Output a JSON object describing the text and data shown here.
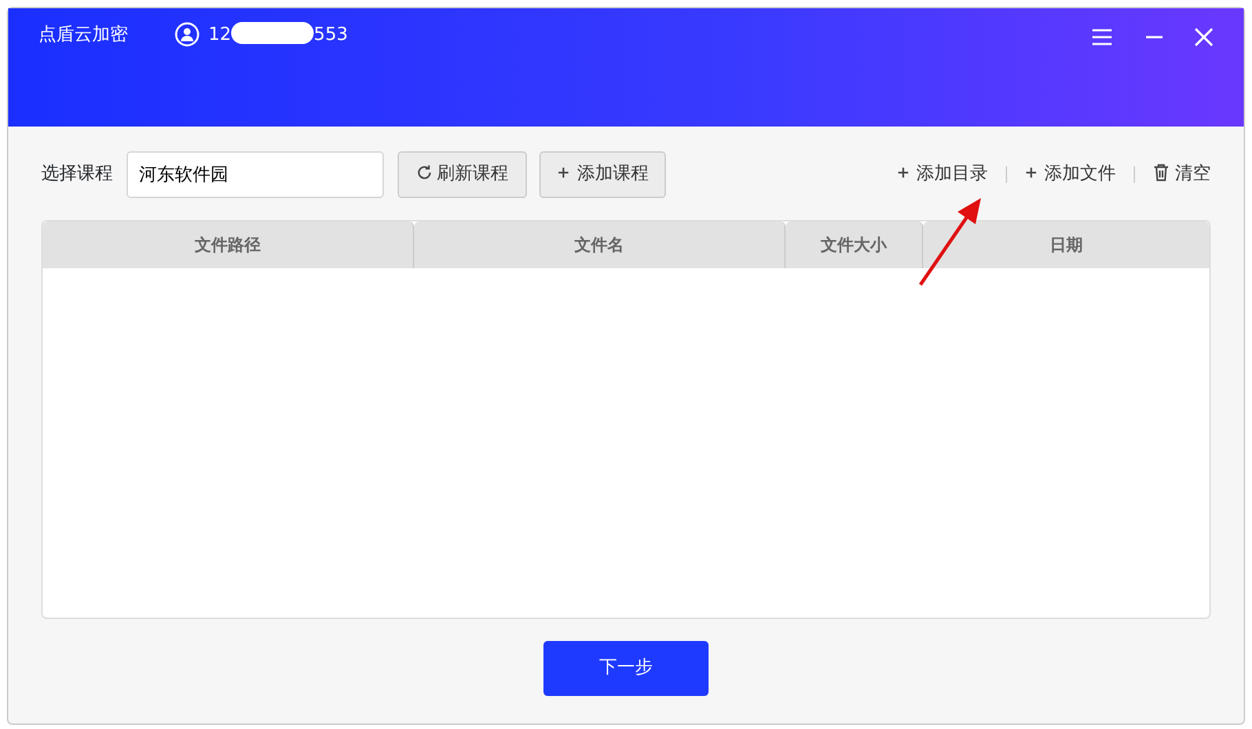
{
  "window": {
    "title": "点盾云加密",
    "account_start": "12",
    "account_end": "553"
  },
  "toolbar": {
    "course_label": "选择课程",
    "course_value": "河东软件园",
    "buttons": [
      {
        "kind": "refresh",
        "label": "刷新课程"
      },
      {
        "kind": "add",
        "label": "添加课程"
      }
    ],
    "links": [
      {
        "kind": "add",
        "label": "添加目录"
      },
      {
        "kind": "add",
        "label": "添加文件"
      },
      {
        "kind": "trash",
        "label": "清空"
      }
    ]
  },
  "table": {
    "columns": [
      "文件路径",
      "文件名",
      "文件大小",
      "日期"
    ]
  },
  "buttons": [
    "下一步"
  ]
}
